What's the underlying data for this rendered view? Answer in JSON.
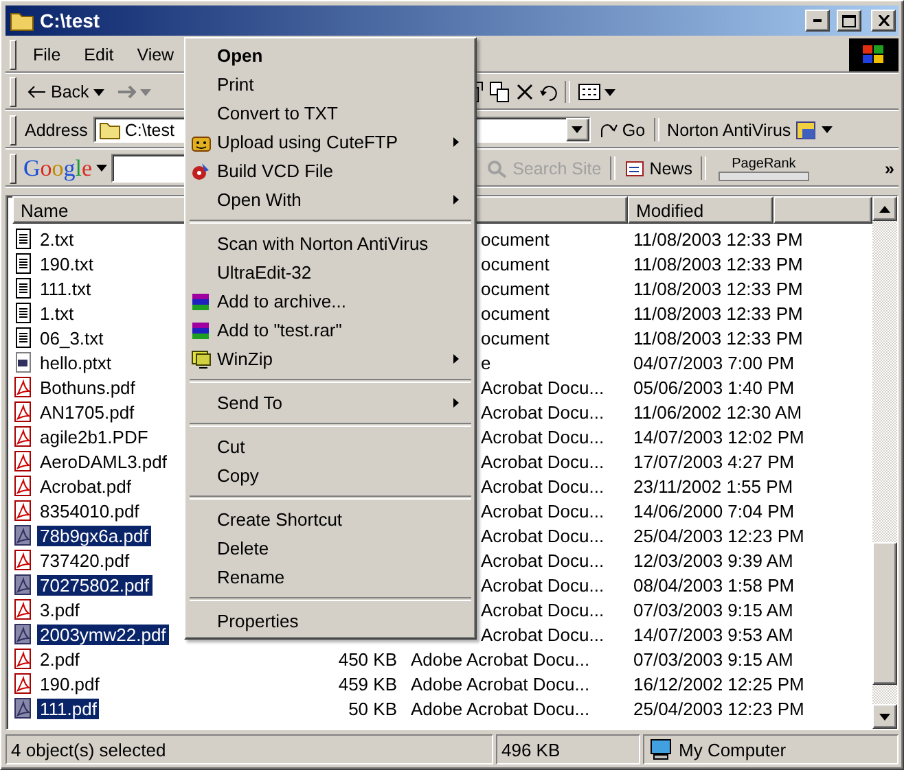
{
  "window": {
    "title": "C:\\test"
  },
  "menu_bar": [
    "File",
    "Edit",
    "View"
  ],
  "toolbar": {
    "back": "Back"
  },
  "address_bar": {
    "label": "Address",
    "value": "C:\\test",
    "go": "Go",
    "norton": "Norton AntiVirus"
  },
  "google_bar": {
    "logo": "Google",
    "search_site": {
      "label": "Search Site",
      "disabled": true
    },
    "news": "News",
    "pagerank": "PageRank",
    "more": "»"
  },
  "columns": [
    {
      "label": "Name"
    },
    {
      "label": "Modified"
    }
  ],
  "files": [
    {
      "name": "2.txt",
      "kind": "text",
      "type": "ocument",
      "partly_hidden": true,
      "modified": "11/08/2003 12:33 PM",
      "selected": false
    },
    {
      "name": "190.txt",
      "kind": "text",
      "type": "ocument",
      "partly_hidden": true,
      "modified": "11/08/2003 12:33 PM",
      "selected": false
    },
    {
      "name": "111.txt",
      "kind": "text",
      "type": "ocument",
      "partly_hidden": true,
      "modified": "11/08/2003 12:33 PM",
      "selected": false
    },
    {
      "name": "1.txt",
      "kind": "text",
      "type": "ocument",
      "partly_hidden": true,
      "modified": "11/08/2003 12:33 PM",
      "selected": false
    },
    {
      "name": "06_3.txt",
      "kind": "text",
      "type": "ocument",
      "partly_hidden": true,
      "modified": "11/08/2003 12:33 PM",
      "selected": false
    },
    {
      "name": "hello.ptxt",
      "kind": "ptxt",
      "type": "e",
      "partly_hidden": true,
      "modified": "04/07/2003 7:00 PM",
      "selected": false
    },
    {
      "name": "Bothuns.pdf",
      "kind": "pdf",
      "type": "Acrobat Docu...",
      "partly_hidden": true,
      "modified": "05/06/2003 1:40 PM",
      "selected": false
    },
    {
      "name": "AN1705.pdf",
      "kind": "pdf",
      "type": "Acrobat Docu...",
      "partly_hidden": true,
      "modified": "11/06/2002 12:30 AM",
      "selected": false
    },
    {
      "name": "agile2b1.PDF",
      "kind": "pdf",
      "type": "Acrobat Docu...",
      "partly_hidden": true,
      "modified": "14/07/2003 12:02 PM",
      "selected": false
    },
    {
      "name": "AeroDAML3.pdf",
      "kind": "pdf",
      "type": "Acrobat Docu...",
      "partly_hidden": true,
      "modified": "17/07/2003 4:27 PM",
      "selected": false
    },
    {
      "name": "Acrobat.pdf",
      "kind": "pdf",
      "type": "Acrobat Docu...",
      "partly_hidden": true,
      "modified": "23/11/2002 1:55 PM",
      "selected": false
    },
    {
      "name": "8354010.pdf",
      "kind": "pdf",
      "type": "Acrobat Docu...",
      "partly_hidden": true,
      "modified": "14/06/2000 7:04 PM",
      "selected": false
    },
    {
      "name": "78b9gx6a.pdf",
      "kind": "pdf",
      "type": "Acrobat Docu...",
      "partly_hidden": true,
      "modified": "25/04/2003 12:23 PM",
      "selected": true
    },
    {
      "name": "737420.pdf",
      "kind": "pdf",
      "type": "Acrobat Docu...",
      "partly_hidden": true,
      "modified": "12/03/2003 9:39 AM",
      "selected": false
    },
    {
      "name": "70275802.pdf",
      "kind": "pdf",
      "type": "Acrobat Docu...",
      "partly_hidden": true,
      "modified": "08/04/2003 1:58 PM",
      "selected": true
    },
    {
      "name": "3.pdf",
      "kind": "pdf",
      "type": "Acrobat Docu...",
      "partly_hidden": true,
      "modified": "07/03/2003 9:15 AM",
      "selected": false
    },
    {
      "name": "2003ymw22.pdf",
      "kind": "pdf",
      "type": "Acrobat Docu...",
      "partly_hidden": true,
      "modified": "14/07/2003 9:53 AM",
      "selected": true
    },
    {
      "name": "2.pdf",
      "kind": "pdf",
      "size": "450 KB",
      "type": "Adobe Acrobat Docu...",
      "partly_hidden": false,
      "modified": "07/03/2003 9:15 AM",
      "selected": false
    },
    {
      "name": "190.pdf",
      "kind": "pdf",
      "size": "459 KB",
      "type": "Adobe Acrobat Docu...",
      "partly_hidden": false,
      "modified": "16/12/2002 12:25 PM",
      "selected": false
    },
    {
      "name": "111.pdf",
      "kind": "pdf",
      "size": "50 KB",
      "type": "Adobe Acrobat Docu...",
      "partly_hidden": false,
      "modified": "25/04/2003 12:23 PM",
      "selected": true
    }
  ],
  "context_menu": [
    {
      "kind": "item",
      "label": "Open",
      "bold": true,
      "submenu": false
    },
    {
      "kind": "item",
      "label": "Print",
      "bold": false,
      "submenu": false
    },
    {
      "kind": "item",
      "label": "Convert to TXT",
      "bold": false,
      "submenu": false
    },
    {
      "kind": "item",
      "label": "Upload using CuteFTP",
      "bold": false,
      "submenu": true
    },
    {
      "kind": "item",
      "label": "Build VCD File",
      "bold": false,
      "submenu": false
    },
    {
      "kind": "item",
      "label": "Open With",
      "bold": false,
      "submenu": true
    },
    {
      "kind": "separator"
    },
    {
      "kind": "item",
      "label": "Scan with Norton AntiVirus",
      "bold": false,
      "submenu": false
    },
    {
      "kind": "item",
      "label": "UltraEdit-32",
      "bold": false,
      "submenu": false
    },
    {
      "kind": "item",
      "label": "Add to archive...",
      "bold": false,
      "submenu": false
    },
    {
      "kind": "item",
      "label": "Add to \"test.rar\"",
      "bold": false,
      "submenu": false
    },
    {
      "kind": "item",
      "label": "WinZip",
      "bold": false,
      "submenu": true
    },
    {
      "kind": "separator"
    },
    {
      "kind": "item",
      "label": "Send To",
      "bold": false,
      "submenu": true
    },
    {
      "kind": "separator"
    },
    {
      "kind": "item",
      "label": "Cut",
      "bold": false,
      "submenu": false
    },
    {
      "kind": "item",
      "label": "Copy",
      "bold": false,
      "submenu": false
    },
    {
      "kind": "separator"
    },
    {
      "kind": "item",
      "label": "Create Shortcut",
      "bold": false,
      "submenu": false
    },
    {
      "kind": "item",
      "label": "Delete",
      "bold": false,
      "submenu": false
    },
    {
      "kind": "item",
      "label": "Rename",
      "bold": false,
      "submenu": false
    },
    {
      "kind": "separator"
    },
    {
      "kind": "item",
      "label": "Properties",
      "bold": false,
      "submenu": false
    }
  ],
  "status_bar": {
    "selection": "4 object(s) selected",
    "size": "496 KB",
    "zone": "My Computer"
  }
}
